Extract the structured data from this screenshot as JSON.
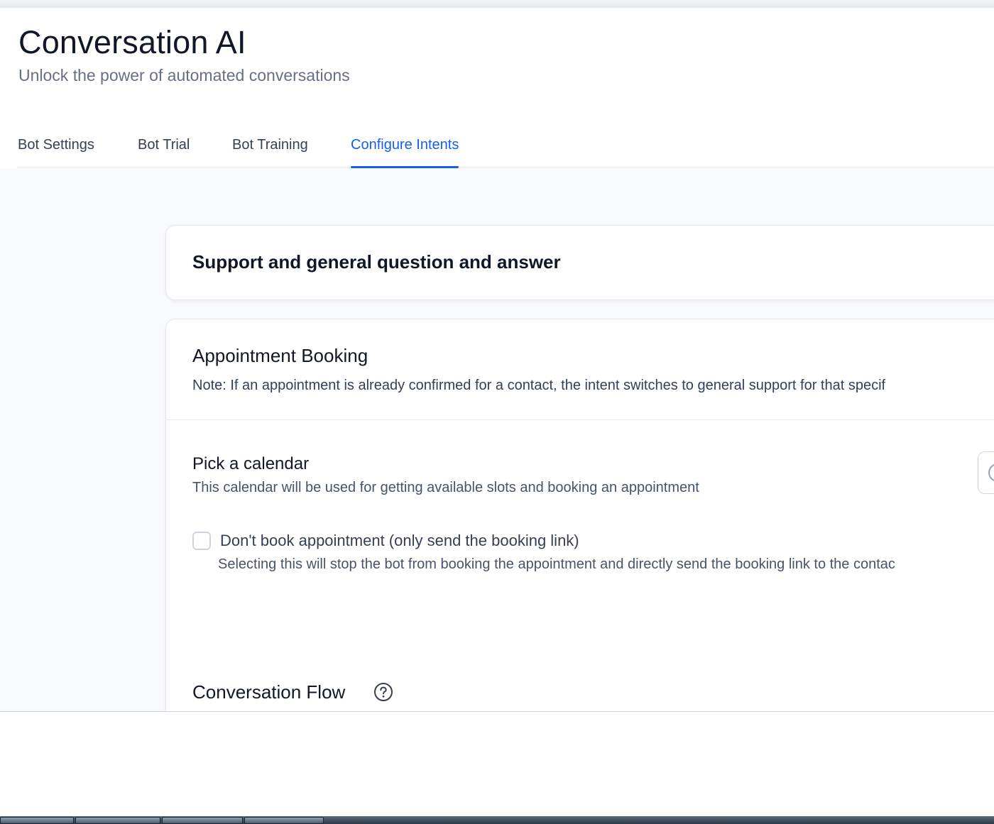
{
  "header": {
    "title": "Conversation AI",
    "subtitle": "Unlock the power of automated conversations"
  },
  "tabs": [
    {
      "label": "Bot Settings",
      "active": false
    },
    {
      "label": "Bot Trial",
      "active": false
    },
    {
      "label": "Bot Training",
      "active": false
    },
    {
      "label": "Configure Intents",
      "active": true
    }
  ],
  "intents": {
    "support": {
      "title": "Support and general question and answer"
    },
    "booking": {
      "title": "Appointment Booking",
      "note": "Note: If an appointment is already confirmed for a contact, the intent switches to general support for that specif",
      "calendar": {
        "label": "Pick a calendar",
        "description": "This calendar will be used for getting available slots and booking an appointment"
      },
      "dont_book": {
        "label": "Don't book appointment (only send the booking link)",
        "description": "Selecting this will stop the bot from booking the appointment and directly send the booking link to the contac",
        "checked": false
      },
      "conversation_flow": {
        "title": "Conversation Flow"
      }
    }
  },
  "colors": {
    "accent": "#155eef",
    "text_primary": "#101828",
    "text_secondary": "#667085",
    "border": "#e4e7ec"
  }
}
